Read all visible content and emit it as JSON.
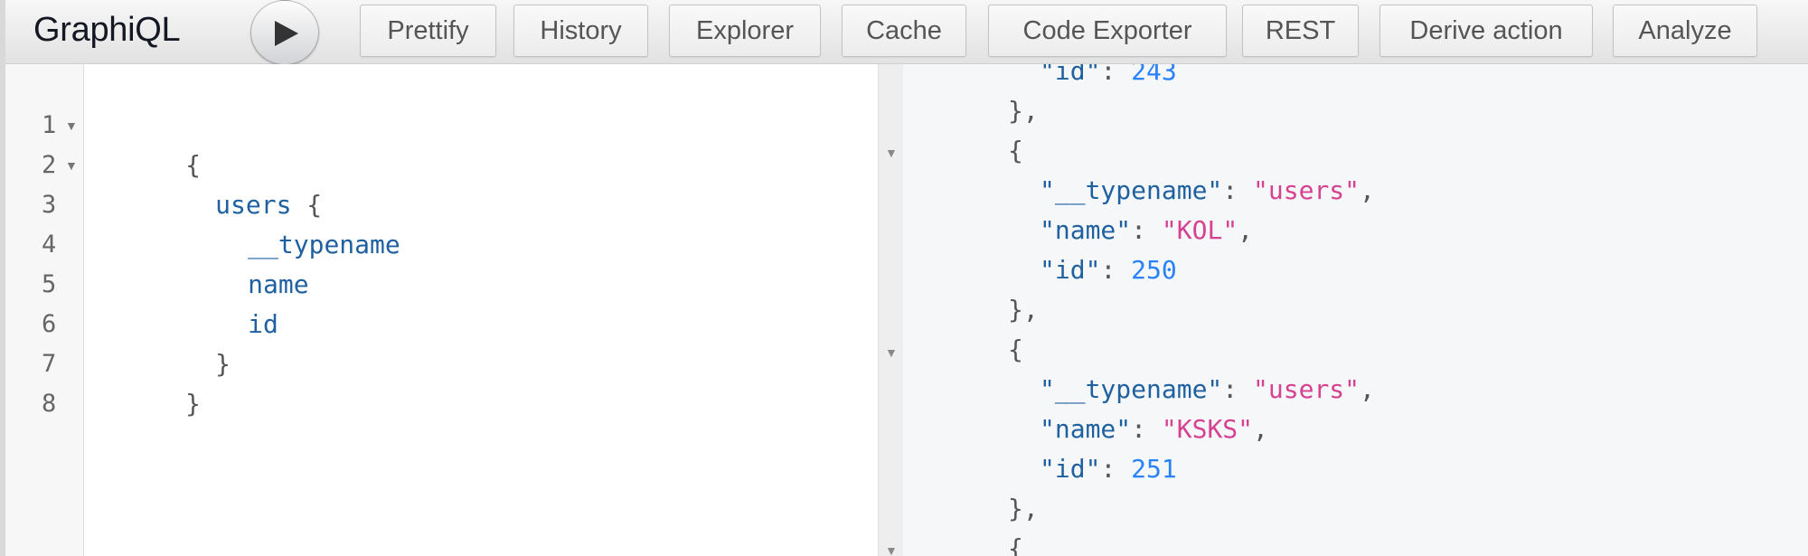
{
  "toolbar": {
    "title": "GraphiQL",
    "run_icon": "play-icon",
    "buttons": [
      "Prettify",
      "History",
      "Explorer",
      "Cache",
      "Code Exporter",
      "REST",
      "Derive action",
      "Analyze"
    ]
  },
  "query_editor": {
    "line_numbers": [
      "1",
      "2",
      "3",
      "4",
      "5",
      "6",
      "7",
      "8"
    ],
    "fold_icon": "fold-arrow-icon",
    "lines": [
      {
        "t": "{"
      },
      {
        "t": "users",
        "rest": " {"
      },
      {
        "t": "__typename"
      },
      {
        "t": "name"
      },
      {
        "t": "id"
      },
      {
        "t": "}"
      },
      {
        "t": "}"
      },
      {
        "t": ""
      }
    ]
  },
  "result": {
    "records": [
      {
        "id": "243"
      },
      {
        "typename": "users",
        "name": "KOL",
        "id": "250"
      },
      {
        "typename": "users",
        "name": "KSKS",
        "id": "251"
      }
    ],
    "tokens": {
      "open": "{",
      "close": "},",
      "typename_key": "\"__typename\"",
      "name_key": "\"name\"",
      "id_key": "\"id\"",
      "colon": ": ",
      "comma": ","
    }
  },
  "colors": {
    "field": "#1f61a0",
    "string": "#d64292",
    "number": "#2882f9"
  }
}
